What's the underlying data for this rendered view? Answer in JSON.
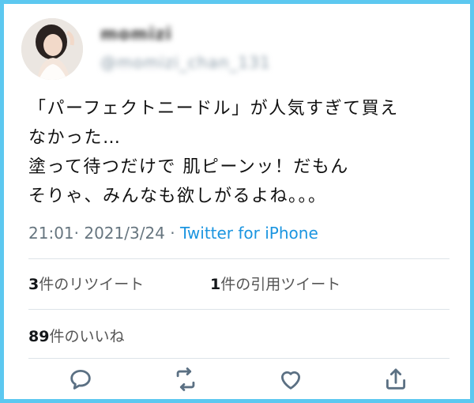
{
  "user": {
    "display_name": "momizi",
    "handle": "@momizi_chan_131"
  },
  "tweet": {
    "lines": [
      "「パーフェクトニードル」が人気すぎて買え",
      "なかった…",
      "塗って待つだけで 肌ピーンッ！だもん",
      "そりゃ、みんなも欲しがるよね。。。"
    ]
  },
  "meta": {
    "time": "21:01",
    "date": "2021/3/24",
    "separator": "·",
    "source": "Twitter for iPhone"
  },
  "stats": {
    "retweets_num": "3",
    "retweets_label": "件のリツイート",
    "quotes_num": "1",
    "quotes_label": "件の引用ツイート",
    "likes_num": "89",
    "likes_label": "件のいいね"
  },
  "colors": {
    "frame_border": "#5cc8f0",
    "link": "#1b95e0",
    "icon": "#5b7083"
  },
  "icons": [
    "reply-icon",
    "retweet-icon",
    "like-icon",
    "share-icon"
  ]
}
